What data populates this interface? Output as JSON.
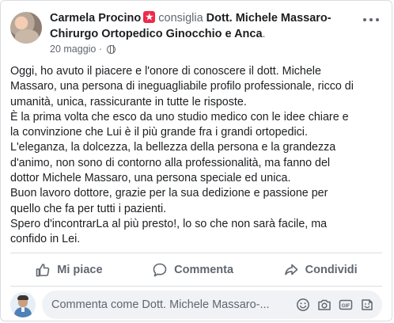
{
  "post": {
    "author": "Carmela Procino",
    "verb": "consiglia",
    "page_name": "Dott. Michele Massaro-Chirurgo Ortopedico Ginocchio e Anca",
    "page_suffix": ".",
    "date": "20 maggio",
    "date_separator": " · ",
    "body": "Oggi, ho avuto il piacere e l'onore di conoscere il dott. Michele\nMassaro, una persona di ineguagliabile profilo professionale, ricco di\numanità, unica, rassicurante in tutte le risposte.\nÈ la prima volta che esco da uno studio medico con le idee chiare e\nla convinzione che Lui è il più grande fra i grandi ortopedici.\nL'eleganza, la dolcezza, la bellezza della persona e la grandezza\nd'animo, non sono di contorno alla professionalità, ma fanno del\ndottor Michele Massaro, una persona speciale ed unica.\nBuon lavoro dottore, grazie per la sua dedizione e passione per\nquello che fa per tutti i pazienti.\nSpero d'incontrarLa al più presto!, lo so che non sarà facile, ma\nconfido in Lei."
  },
  "actions": {
    "like_label": "Mi piace",
    "comment_label": "Commenta",
    "share_label": "Condividi"
  },
  "comment_box": {
    "placeholder": "Commenta come Dott. Michele Massaro-..."
  },
  "colors": {
    "secondary_text": "#606770",
    "badge": "#f02849",
    "divider": "#dadde1",
    "input_bg": "#f0f2f5"
  },
  "icons": [
    "more-icon",
    "recommend-badge-icon",
    "globe-icon",
    "like-icon",
    "comment-icon",
    "share-icon",
    "emoji-icon",
    "camera-icon",
    "gif-icon",
    "sticker-icon"
  ]
}
